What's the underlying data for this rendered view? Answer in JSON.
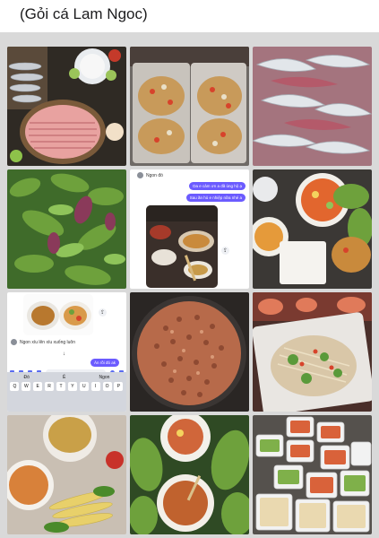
{
  "caption": "(Gỏi cá Lam Ngoc)",
  "chat1": {
    "sender": "Ngon đó",
    "messages": [
      "Da e cảm ơn a đã ủng hộ ạ",
      "Sau ăn hủ e nhiệp nữa nhé a"
    ]
  },
  "chat2": {
    "received": "Ngon xíu lên xíu xuống luôn",
    "sent": "Ăn rồi đó ak",
    "suggestions": [
      "Đó",
      "Ẻ",
      "Ngon"
    ],
    "keys": [
      "Q",
      "W",
      "E",
      "R",
      "T",
      "Y",
      "U",
      "I",
      "O",
      "P"
    ]
  },
  "colors": {
    "background": "#d9d9d9",
    "bubble": "#6b5bff",
    "keyboard": "#d3d6dd"
  }
}
